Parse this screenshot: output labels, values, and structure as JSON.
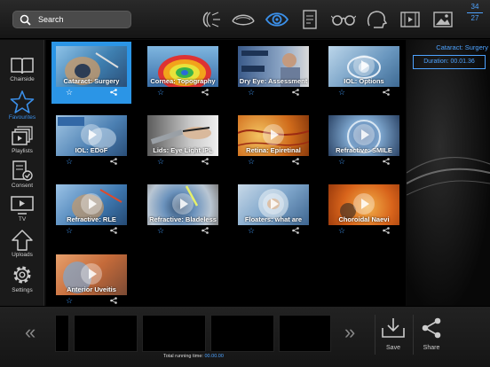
{
  "search": {
    "label": "Search"
  },
  "toolbar": {
    "icons": [
      "lens-icon",
      "contact-lens-icon",
      "eye-icon",
      "document-icon",
      "glasses-icon",
      "head-profile-icon",
      "film-icon",
      "image-icon"
    ],
    "active_index": 2,
    "counter_top": "34",
    "counter_bottom": "27"
  },
  "sidebar": {
    "items": [
      {
        "label": "Chairside",
        "icon": "book-icon"
      },
      {
        "label": "Favourites",
        "icon": "star-icon",
        "active": true
      },
      {
        "label": "Playlists",
        "icon": "playlist-icon"
      },
      {
        "label": "Consent",
        "icon": "consent-icon"
      },
      {
        "label": "TV",
        "icon": "tv-icon"
      },
      {
        "label": "Uploads",
        "icon": "upload-icon"
      },
      {
        "label": "Settings",
        "icon": "gear-icon"
      }
    ]
  },
  "videos": [
    {
      "title": "Cataract: Surgery",
      "selected": true
    },
    {
      "title": "Cornea: Topography"
    },
    {
      "title": "Dry Eye: Assessment"
    },
    {
      "title": "IOL: Options"
    },
    {
      "title": "IOL: EDoF"
    },
    {
      "title": "Lids: Eye Light IPL"
    },
    {
      "title": "Retina: Epiretinal"
    },
    {
      "title": "Refractive: SMILE"
    },
    {
      "title": "Refractive: RLE"
    },
    {
      "title": "Refractive: Bladeless"
    },
    {
      "title": "Floaters: what are"
    },
    {
      "title": "Choroidal Naevi"
    },
    {
      "title": "Anterior Uveitis"
    }
  ],
  "preview": {
    "title": "Cataract: Surgery",
    "duration": "Duration: 00.01.36"
  },
  "bottombar": {
    "total_label": "Total running time:",
    "total_value": "00.00.00",
    "save_label": "Save",
    "share_label": "Share"
  },
  "colors": {
    "accent": "#3b8fe8",
    "selected": "#2b95e6"
  }
}
